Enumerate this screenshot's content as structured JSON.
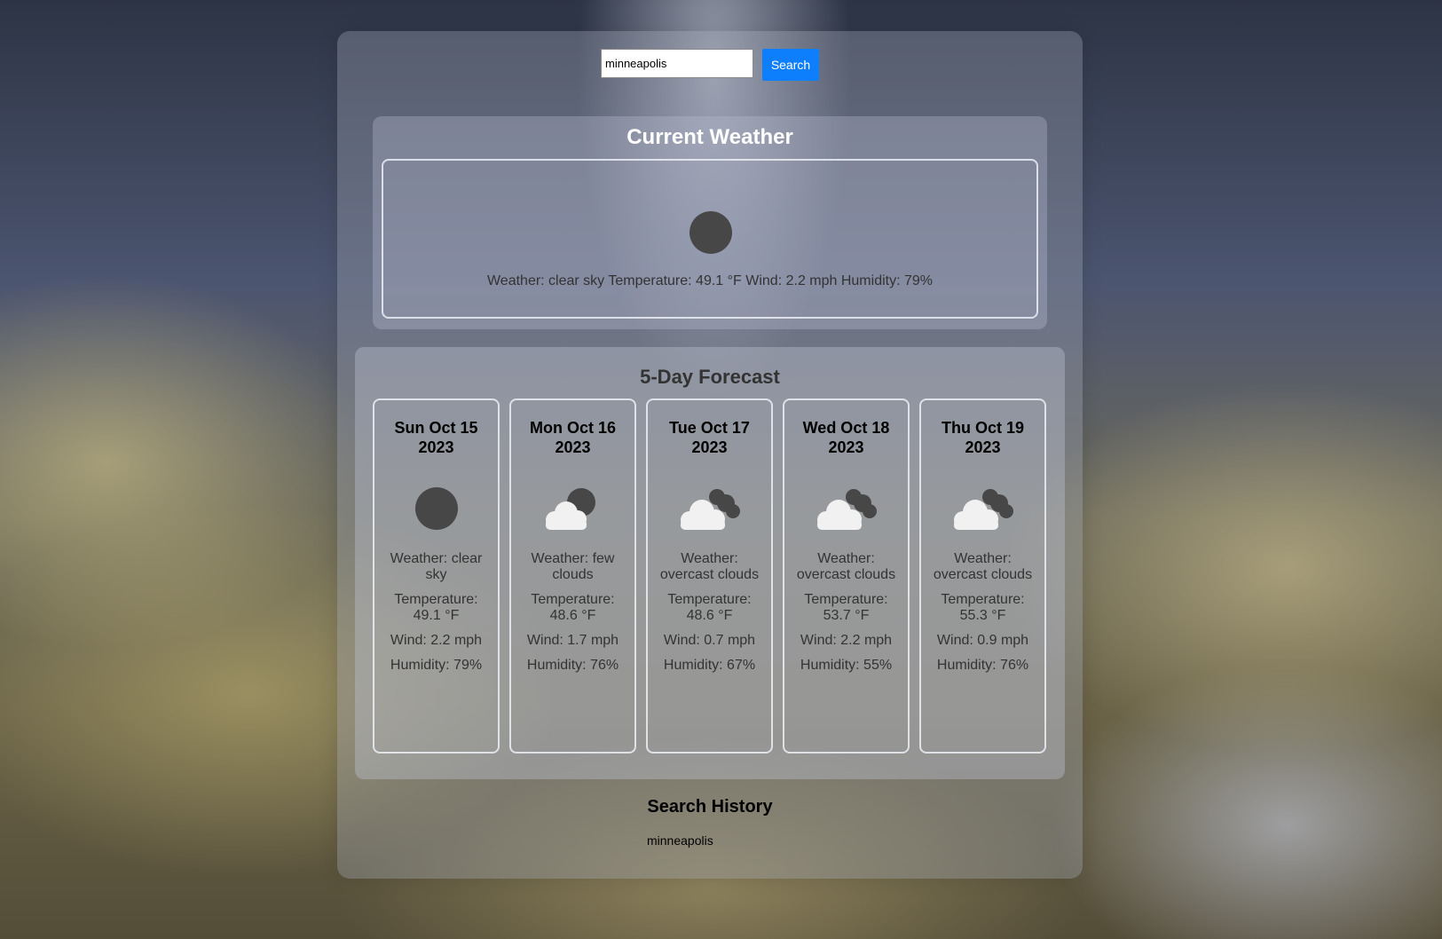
{
  "search": {
    "value": "minneapolis",
    "button_label": "Search"
  },
  "current": {
    "title": "Current Weather",
    "icon": "clear-sky-icon",
    "summary": "Weather: clear sky Temperature: 49.1 °F Wind: 2.2 mph Humidity: 79%"
  },
  "forecast": {
    "title": "5-Day Forecast",
    "days": [
      {
        "date": "Sun Oct 15 2023",
        "icon": "clear-sky-icon",
        "weather": "Weather: clear sky",
        "temperature": "Temperature: 49.1 °F",
        "wind": "Wind: 2.2 mph",
        "humidity": "Humidity: 79%"
      },
      {
        "date": "Mon Oct 16 2023",
        "icon": "few-clouds-icon",
        "weather": "Weather: few clouds",
        "temperature": "Temperature: 48.6 °F",
        "wind": "Wind: 1.7 mph",
        "humidity": "Humidity: 76%"
      },
      {
        "date": "Tue Oct 17 2023",
        "icon": "overcast-clouds-icon",
        "weather": "Weather: overcast clouds",
        "temperature": "Temperature: 48.6 °F",
        "wind": "Wind: 0.7 mph",
        "humidity": "Humidity: 67%"
      },
      {
        "date": "Wed Oct 18 2023",
        "icon": "overcast-clouds-icon",
        "weather": "Weather: overcast clouds",
        "temperature": "Temperature: 53.7 °F",
        "wind": "Wind: 2.2 mph",
        "humidity": "Humidity: 55%"
      },
      {
        "date": "Thu Oct 19 2023",
        "icon": "overcast-clouds-icon",
        "weather": "Weather: overcast clouds",
        "temperature": "Temperature: 55.3 °F",
        "wind": "Wind: 0.9 mph",
        "humidity": "Humidity: 76%"
      }
    ]
  },
  "history": {
    "title": "Search History",
    "items": [
      "minneapolis"
    ]
  },
  "colors": {
    "accent": "#0d7efc",
    "icon_dark": "#474747",
    "cloud": "#f1f1f1"
  }
}
